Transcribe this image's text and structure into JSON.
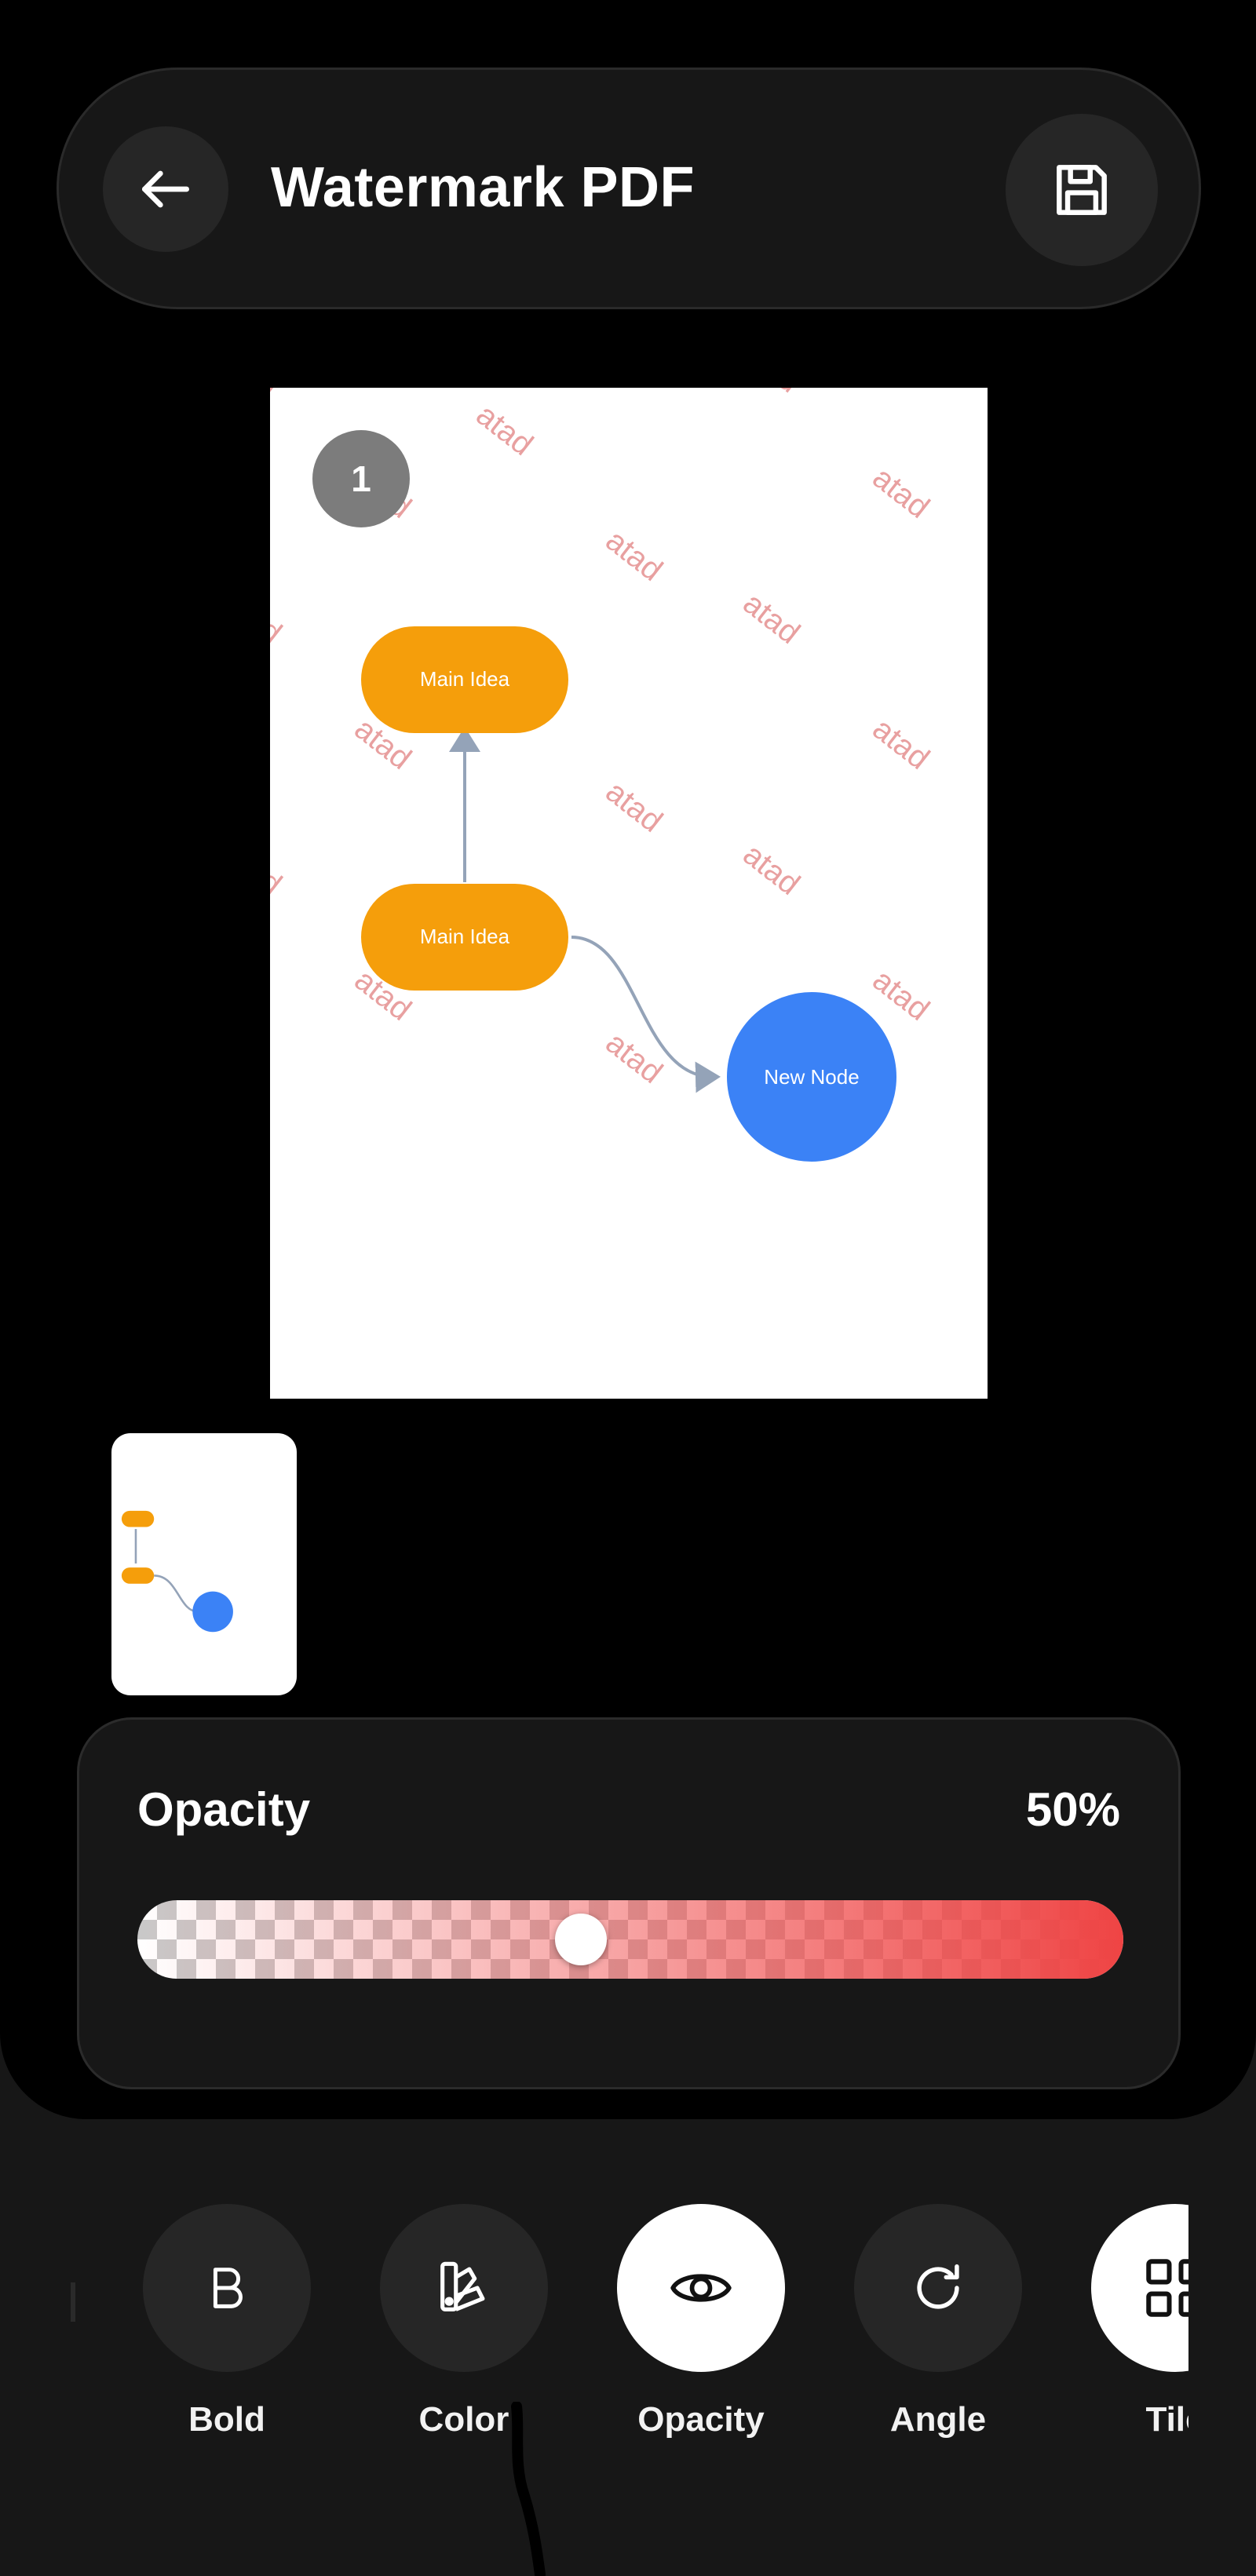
{
  "header": {
    "title": "Watermark PDF",
    "back_icon": "arrow-left-icon",
    "save_icon": "save-icon"
  },
  "preview": {
    "page_number": "1",
    "watermark_text": "atad",
    "watermark_color": "#e8a0a0",
    "nodes": {
      "top_label": "Main Idea",
      "middle_label": "Main Idea",
      "new_label": "New Node"
    },
    "node_colors": {
      "idea": "#f59e0b",
      "new": "#3b82f6"
    }
  },
  "opacity": {
    "label": "Opacity",
    "value_text": "50%",
    "value": 0.45,
    "accent": "#ef4444"
  },
  "toolbar": {
    "items": [
      {
        "label": "Bold",
        "icon": "bold-icon"
      },
      {
        "label": "Color",
        "icon": "color-palette-icon"
      },
      {
        "label": "Opacity",
        "icon": "eye-icon",
        "active": true
      },
      {
        "label": "Angle",
        "icon": "rotate-icon"
      },
      {
        "label": "Tile",
        "icon": "grid-icon",
        "active": true
      }
    ]
  }
}
